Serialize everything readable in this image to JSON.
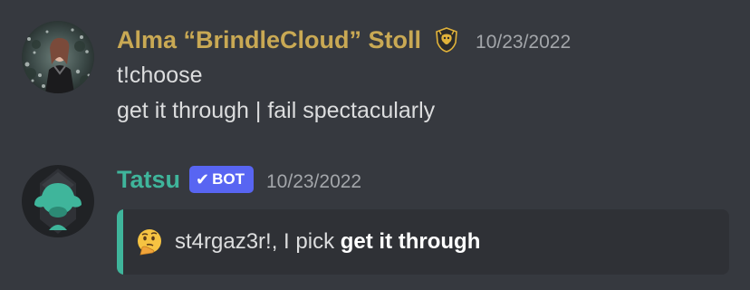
{
  "messages": [
    {
      "author": "Alma “BrindleCloud” Stoll",
      "role_icon": "house-crest-icon",
      "timestamp": "10/23/2022",
      "lines": [
        "t!choose",
        "get it through | fail spectacularly"
      ]
    },
    {
      "author": "Tatsu",
      "badge": "BOT",
      "timestamp": "10/23/2022",
      "embed": {
        "emoji": "thinking-face-icon",
        "mention": "st4rgaz3r!",
        "text": ", I pick ",
        "choice": "get it through",
        "accent_color": "#3fb59b"
      }
    }
  ],
  "colors": {
    "background": "#36393f",
    "alma_name": "#c9a954",
    "tatsu_name": "#3fb59b",
    "bot_badge": "#5865f2",
    "embed_bg": "#2f3136"
  }
}
